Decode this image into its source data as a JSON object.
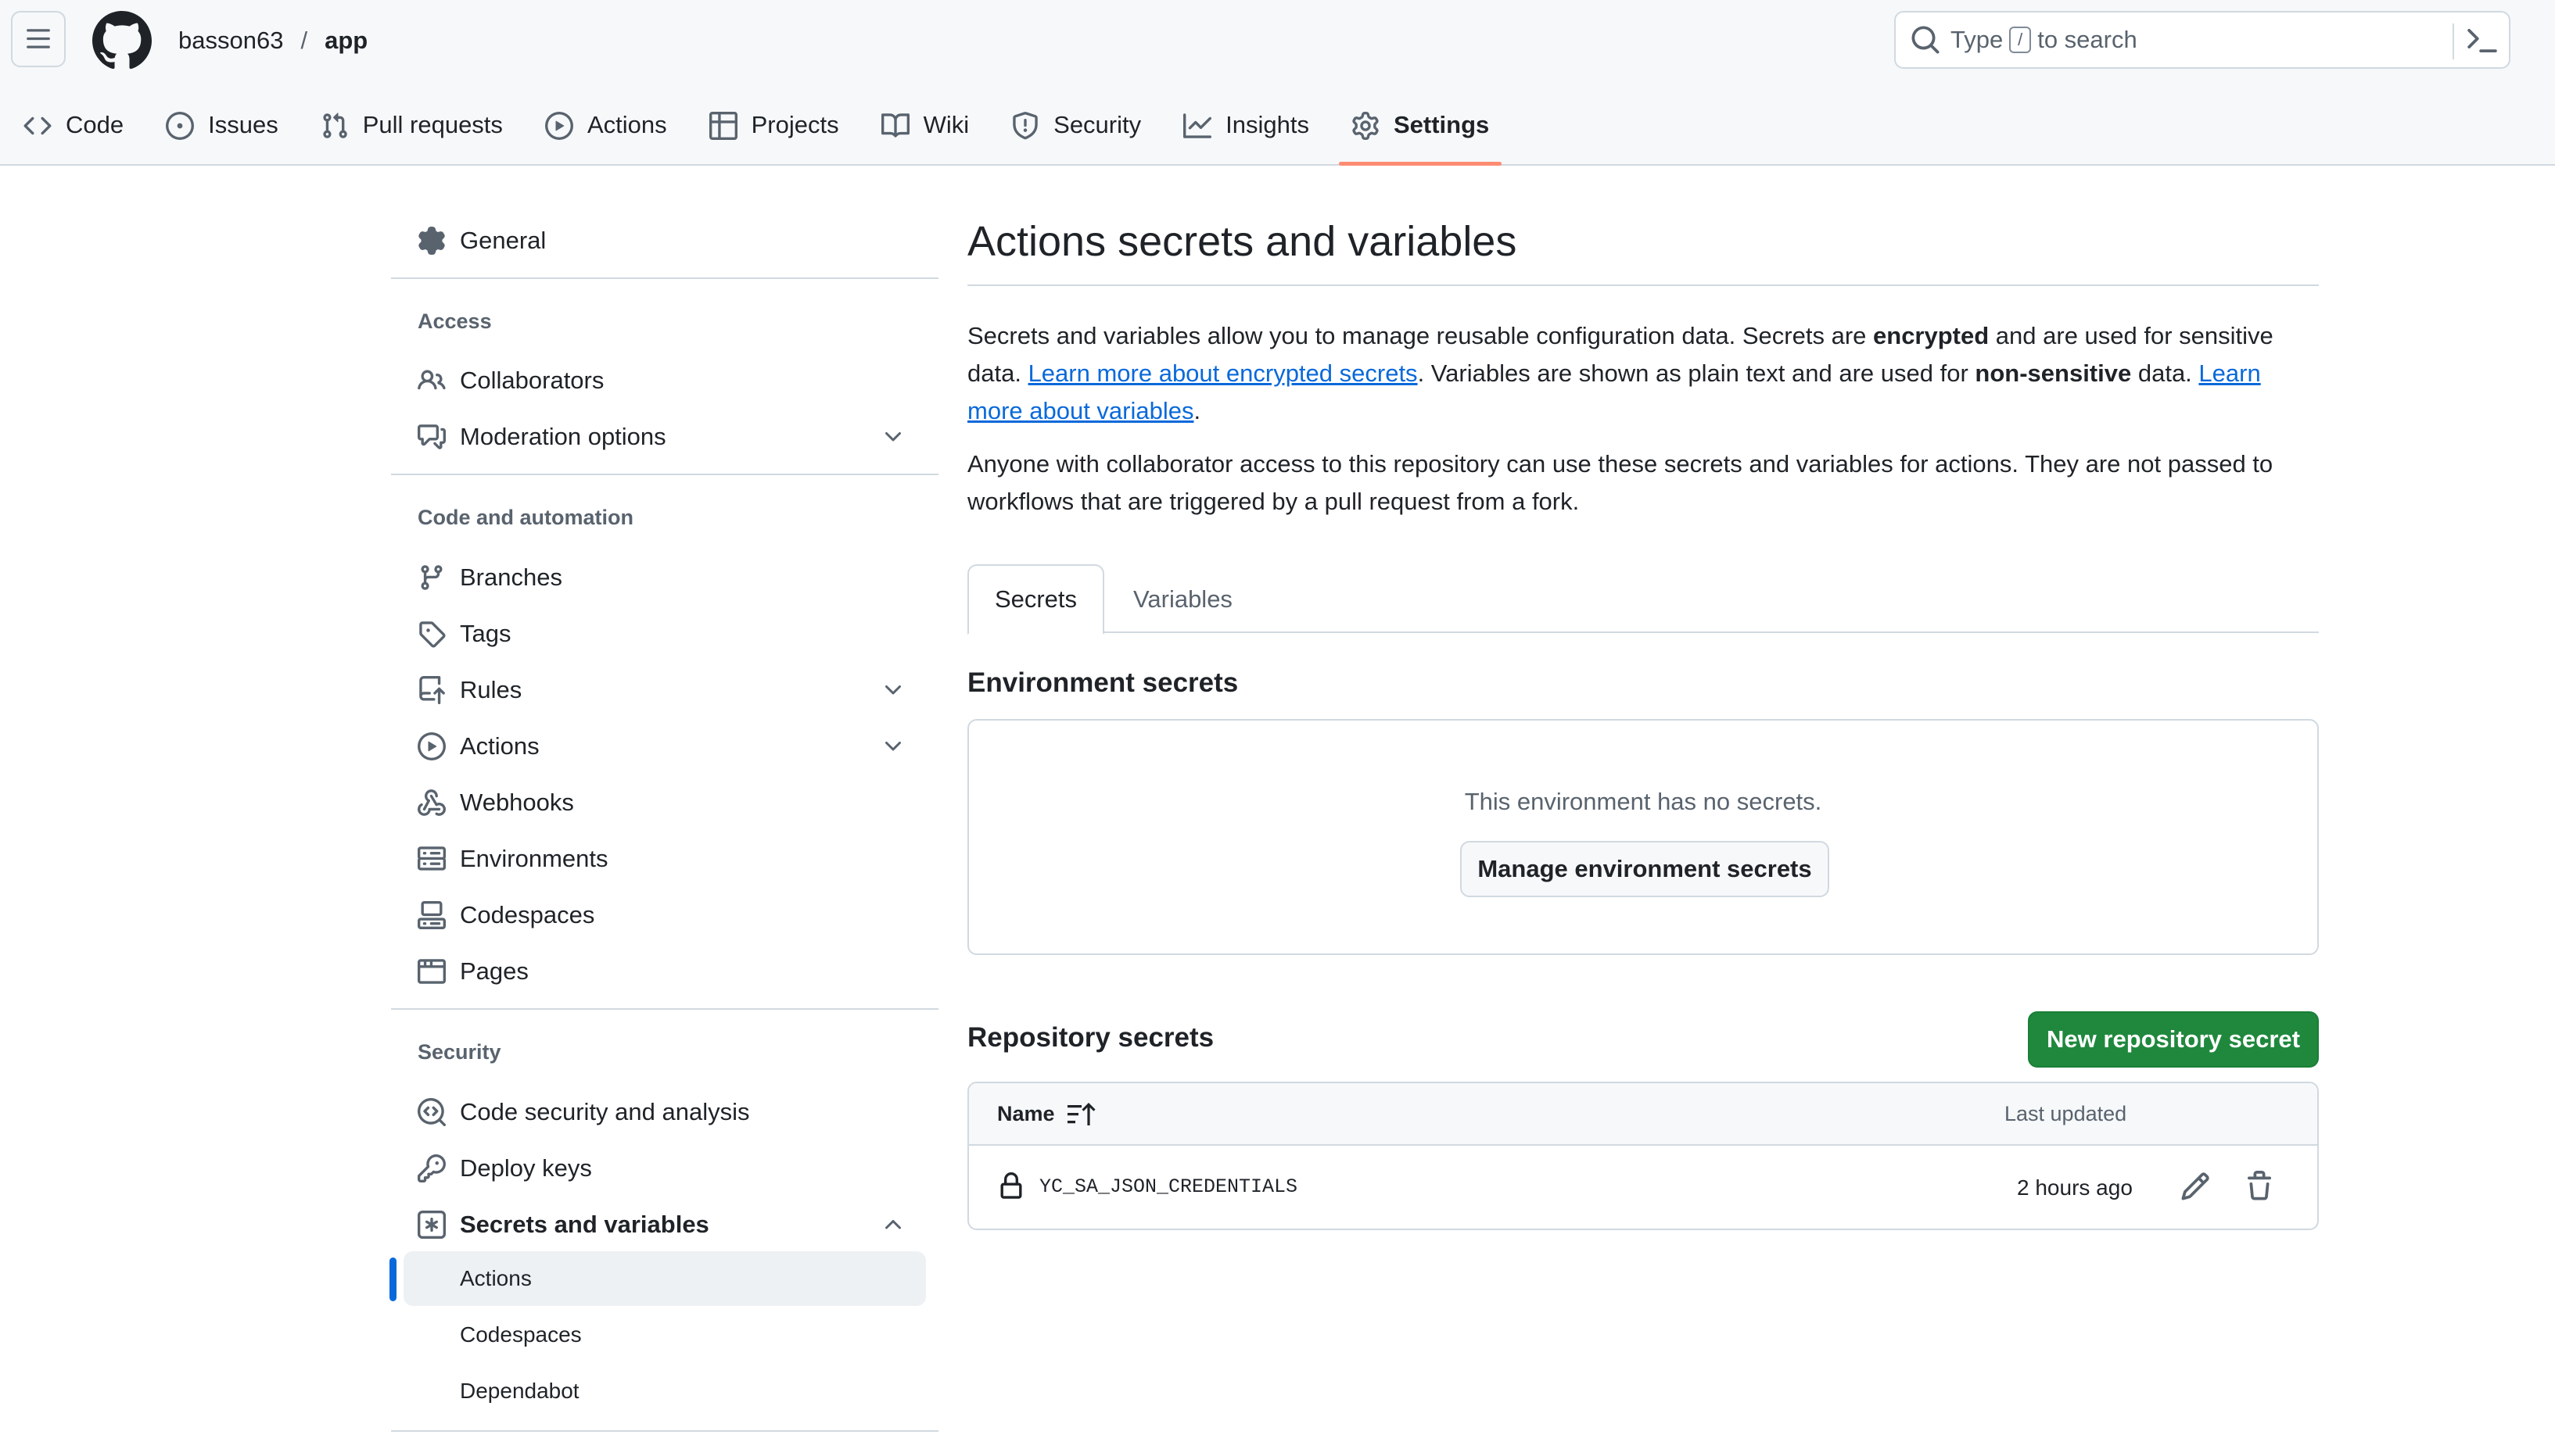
{
  "header": {
    "owner": "basson63",
    "separator": "/",
    "repo": "app",
    "search_prefix": "Type",
    "search_key": "/",
    "search_suffix": "to search"
  },
  "tabs": [
    {
      "label": "Code",
      "icon": "code-icon"
    },
    {
      "label": "Issues",
      "icon": "issue-opened-icon"
    },
    {
      "label": "Pull requests",
      "icon": "git-pull-request-icon"
    },
    {
      "label": "Actions",
      "icon": "play-icon"
    },
    {
      "label": "Projects",
      "icon": "table-icon"
    },
    {
      "label": "Wiki",
      "icon": "book-icon"
    },
    {
      "label": "Security",
      "icon": "shield-icon"
    },
    {
      "label": "Insights",
      "icon": "graph-icon"
    },
    {
      "label": "Settings",
      "icon": "gear-icon",
      "active": true
    }
  ],
  "sidebar": {
    "general": "General",
    "access_heading": "Access",
    "collaborators": "Collaborators",
    "moderation": "Moderation options",
    "code_heading": "Code and automation",
    "branches": "Branches",
    "tags": "Tags",
    "rules": "Rules",
    "actions": "Actions",
    "webhooks": "Webhooks",
    "environments": "Environments",
    "codespaces": "Codespaces",
    "pages": "Pages",
    "security_heading": "Security",
    "code_security": "Code security and analysis",
    "deploy_keys": "Deploy keys",
    "secrets_variables": "Secrets and variables",
    "sub_actions": "Actions",
    "sub_codespaces": "Codespaces",
    "sub_dependabot": "Dependabot"
  },
  "main": {
    "title": "Actions secrets and variables",
    "p1_a": "Secrets and variables allow you to manage reusable configuration data. Secrets are ",
    "p1_b": "encrypted",
    "p1_c": " and are used for sensitive data. ",
    "p1_link1": "Learn more about encrypted secrets",
    "p1_d": ". Variables are shown as plain text and are used for ",
    "p1_e": "non-sensitive",
    "p1_f": " data. ",
    "p1_link2": "Learn more about variables",
    "p1_g": ".",
    "p2": "Anyone with collaborator access to this repository can use these secrets and variables for actions. They are not passed to workflows that are triggered by a pull request from a fork.",
    "tab_secrets": "Secrets",
    "tab_variables": "Variables",
    "env_heading": "Environment secrets",
    "env_empty": "This environment has no secrets.",
    "env_button": "Manage environment secrets",
    "repo_heading": "Repository secrets",
    "new_button": "New repository secret",
    "col_name": "Name",
    "col_updated": "Last updated",
    "secrets": [
      {
        "name": "YC_SA_JSON_CREDENTIALS",
        "updated": "2 hours ago"
      }
    ]
  },
  "colors": {
    "accent_link": "#0969da",
    "primary_button": "#1f883d",
    "active_tab_underline": "#fd8c73",
    "border": "#d1d9e0"
  }
}
